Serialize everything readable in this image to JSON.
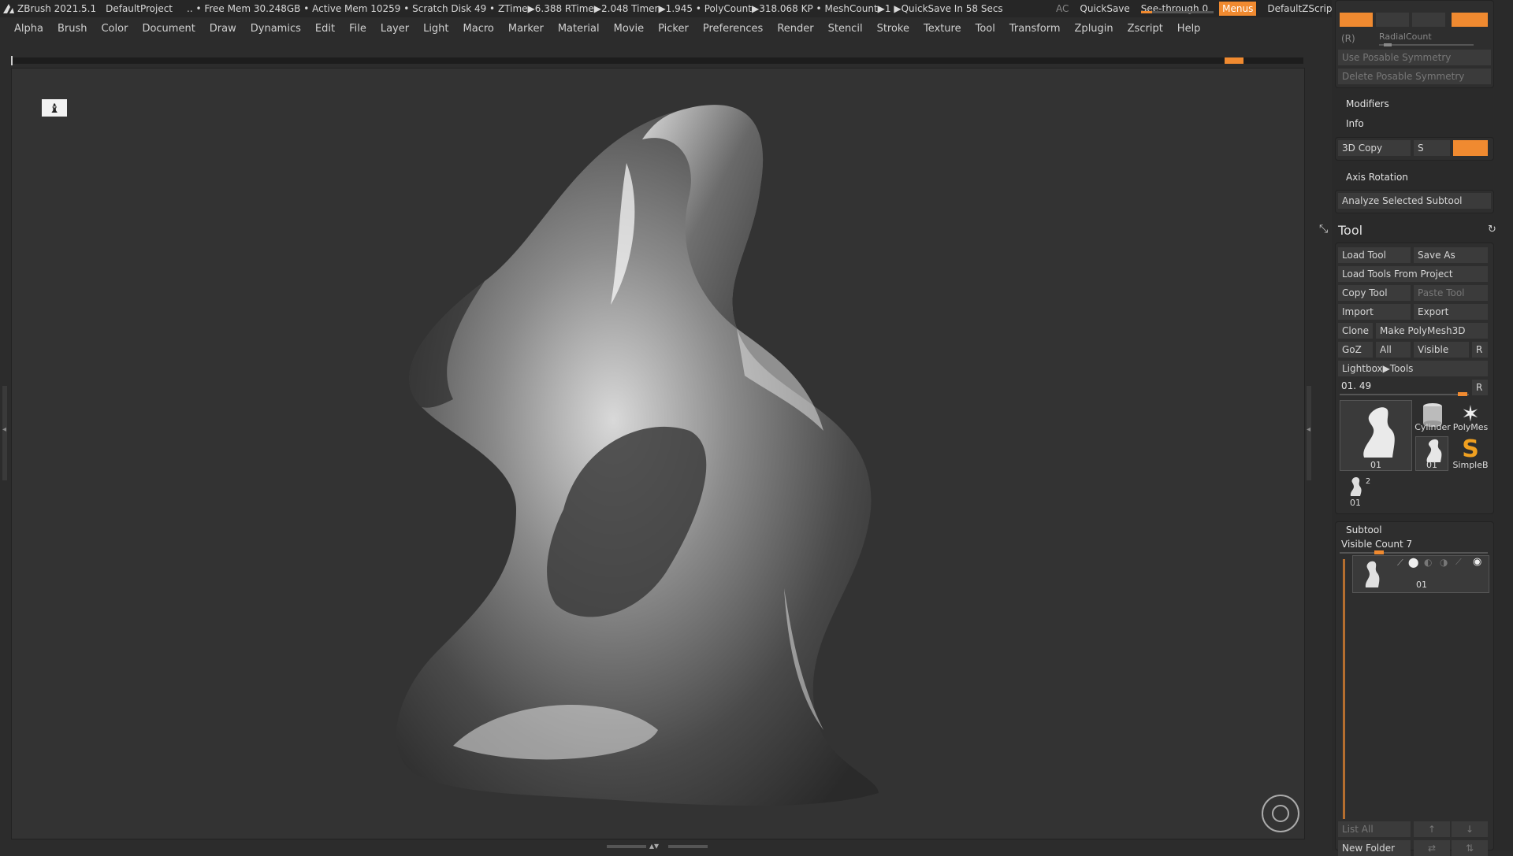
{
  "titlebar": {
    "app": "ZBrush 2021.5.1",
    "project": "DefaultProject",
    "stats": ".. • Free Mem 30.248GB • Active Mem 10259 • Scratch Disk 49 • ZTime▶6.388 RTime▶2.048 Timer▶1.945 • PolyCount▶318.068 KP • MeshCount▶1 ▶QuickSave In 58 Secs",
    "ac": "AC",
    "quicksave": "QuickSave",
    "seethrough": "See-through",
    "seethrough_value": "0",
    "seethrough_fill": 0.15,
    "menus": "Menus",
    "script": "DefaultZScript"
  },
  "menubar": [
    "Alpha",
    "Brush",
    "Color",
    "Document",
    "Draw",
    "Dynamics",
    "Edit",
    "File",
    "Layer",
    "Light",
    "Macro",
    "Marker",
    "Material",
    "Movie",
    "Picker",
    "Preferences",
    "Render",
    "Stencil",
    "Stroke",
    "Texture",
    "Tool",
    "Transform",
    "Zplugin",
    "Zscript",
    "Help"
  ],
  "panel": {
    "symmetry": {
      "r_label": "(R)",
      "radialcount": "RadialCount",
      "use_posable": "Use Posable Symmetry",
      "delete_posable": "Delete Posable Symmetry"
    },
    "modifiers": "Modifiers",
    "info": "Info",
    "copy3d": "3D Copy",
    "s_label": "S",
    "axis_rotation": "Axis Rotation",
    "analyze": "Analyze Selected Subtool",
    "tool": {
      "title": "Tool",
      "load_tool": "Load Tool",
      "save_as": "Save As",
      "load_from_project": "Load Tools From Project",
      "copy_tool": "Copy Tool",
      "paste_tool": "Paste Tool",
      "import": "Import",
      "export": "Export",
      "clone": "Clone",
      "make_polymesh": "Make PolyMesh3D",
      "goz": "GoZ",
      "all": "All",
      "visible": "Visible",
      "r": "R",
      "lightbox_tools": "Lightbox▶Tools",
      "slider_value": "01. 49",
      "slider_r": "R",
      "thumbs": {
        "main": "01",
        "cylinder": "Cylinder",
        "polymesh": "PolyMes",
        "small": "01",
        "simpleb": "SimpleB",
        "count": "2",
        "bottom": "01"
      }
    },
    "subtool": {
      "title": "Subtool",
      "visible_count": "Visible Count 7",
      "item": "01",
      "list_all": "List All",
      "new_folder": "New Folder"
    }
  },
  "colors": {
    "accent": "#f08a30",
    "background": "#2c2c2c",
    "canvas": "#333333"
  }
}
